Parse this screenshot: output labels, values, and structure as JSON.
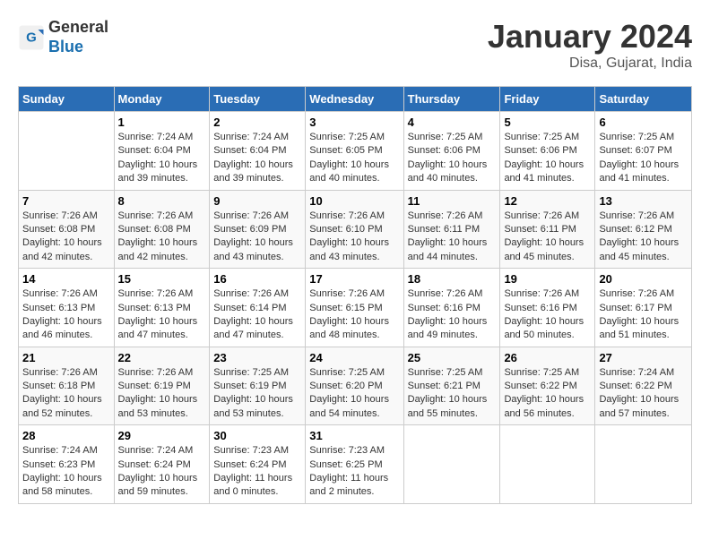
{
  "header": {
    "logo_general": "General",
    "logo_blue": "Blue",
    "month_year": "January 2024",
    "location": "Disa, Gujarat, India"
  },
  "days_of_week": [
    "Sunday",
    "Monday",
    "Tuesday",
    "Wednesday",
    "Thursday",
    "Friday",
    "Saturday"
  ],
  "weeks": [
    [
      {
        "day": "",
        "info": ""
      },
      {
        "day": "1",
        "info": "Sunrise: 7:24 AM\nSunset: 6:04 PM\nDaylight: 10 hours\nand 39 minutes."
      },
      {
        "day": "2",
        "info": "Sunrise: 7:24 AM\nSunset: 6:04 PM\nDaylight: 10 hours\nand 39 minutes."
      },
      {
        "day": "3",
        "info": "Sunrise: 7:25 AM\nSunset: 6:05 PM\nDaylight: 10 hours\nand 40 minutes."
      },
      {
        "day": "4",
        "info": "Sunrise: 7:25 AM\nSunset: 6:06 PM\nDaylight: 10 hours\nand 40 minutes."
      },
      {
        "day": "5",
        "info": "Sunrise: 7:25 AM\nSunset: 6:06 PM\nDaylight: 10 hours\nand 41 minutes."
      },
      {
        "day": "6",
        "info": "Sunrise: 7:25 AM\nSunset: 6:07 PM\nDaylight: 10 hours\nand 41 minutes."
      }
    ],
    [
      {
        "day": "7",
        "info": "Sunrise: 7:26 AM\nSunset: 6:08 PM\nDaylight: 10 hours\nand 42 minutes."
      },
      {
        "day": "8",
        "info": "Sunrise: 7:26 AM\nSunset: 6:08 PM\nDaylight: 10 hours\nand 42 minutes."
      },
      {
        "day": "9",
        "info": "Sunrise: 7:26 AM\nSunset: 6:09 PM\nDaylight: 10 hours\nand 43 minutes."
      },
      {
        "day": "10",
        "info": "Sunrise: 7:26 AM\nSunset: 6:10 PM\nDaylight: 10 hours\nand 43 minutes."
      },
      {
        "day": "11",
        "info": "Sunrise: 7:26 AM\nSunset: 6:11 PM\nDaylight: 10 hours\nand 44 minutes."
      },
      {
        "day": "12",
        "info": "Sunrise: 7:26 AM\nSunset: 6:11 PM\nDaylight: 10 hours\nand 45 minutes."
      },
      {
        "day": "13",
        "info": "Sunrise: 7:26 AM\nSunset: 6:12 PM\nDaylight: 10 hours\nand 45 minutes."
      }
    ],
    [
      {
        "day": "14",
        "info": "Sunrise: 7:26 AM\nSunset: 6:13 PM\nDaylight: 10 hours\nand 46 minutes."
      },
      {
        "day": "15",
        "info": "Sunrise: 7:26 AM\nSunset: 6:13 PM\nDaylight: 10 hours\nand 47 minutes."
      },
      {
        "day": "16",
        "info": "Sunrise: 7:26 AM\nSunset: 6:14 PM\nDaylight: 10 hours\nand 47 minutes."
      },
      {
        "day": "17",
        "info": "Sunrise: 7:26 AM\nSunset: 6:15 PM\nDaylight: 10 hours\nand 48 minutes."
      },
      {
        "day": "18",
        "info": "Sunrise: 7:26 AM\nSunset: 6:16 PM\nDaylight: 10 hours\nand 49 minutes."
      },
      {
        "day": "19",
        "info": "Sunrise: 7:26 AM\nSunset: 6:16 PM\nDaylight: 10 hours\nand 50 minutes."
      },
      {
        "day": "20",
        "info": "Sunrise: 7:26 AM\nSunset: 6:17 PM\nDaylight: 10 hours\nand 51 minutes."
      }
    ],
    [
      {
        "day": "21",
        "info": "Sunrise: 7:26 AM\nSunset: 6:18 PM\nDaylight: 10 hours\nand 52 minutes."
      },
      {
        "day": "22",
        "info": "Sunrise: 7:26 AM\nSunset: 6:19 PM\nDaylight: 10 hours\nand 53 minutes."
      },
      {
        "day": "23",
        "info": "Sunrise: 7:25 AM\nSunset: 6:19 PM\nDaylight: 10 hours\nand 53 minutes."
      },
      {
        "day": "24",
        "info": "Sunrise: 7:25 AM\nSunset: 6:20 PM\nDaylight: 10 hours\nand 54 minutes."
      },
      {
        "day": "25",
        "info": "Sunrise: 7:25 AM\nSunset: 6:21 PM\nDaylight: 10 hours\nand 55 minutes."
      },
      {
        "day": "26",
        "info": "Sunrise: 7:25 AM\nSunset: 6:22 PM\nDaylight: 10 hours\nand 56 minutes."
      },
      {
        "day": "27",
        "info": "Sunrise: 7:24 AM\nSunset: 6:22 PM\nDaylight: 10 hours\nand 57 minutes."
      }
    ],
    [
      {
        "day": "28",
        "info": "Sunrise: 7:24 AM\nSunset: 6:23 PM\nDaylight: 10 hours\nand 58 minutes."
      },
      {
        "day": "29",
        "info": "Sunrise: 7:24 AM\nSunset: 6:24 PM\nDaylight: 10 hours\nand 59 minutes."
      },
      {
        "day": "30",
        "info": "Sunrise: 7:23 AM\nSunset: 6:24 PM\nDaylight: 11 hours\nand 0 minutes."
      },
      {
        "day": "31",
        "info": "Sunrise: 7:23 AM\nSunset: 6:25 PM\nDaylight: 11 hours\nand 2 minutes."
      },
      {
        "day": "",
        "info": ""
      },
      {
        "day": "",
        "info": ""
      },
      {
        "day": "",
        "info": ""
      }
    ]
  ]
}
